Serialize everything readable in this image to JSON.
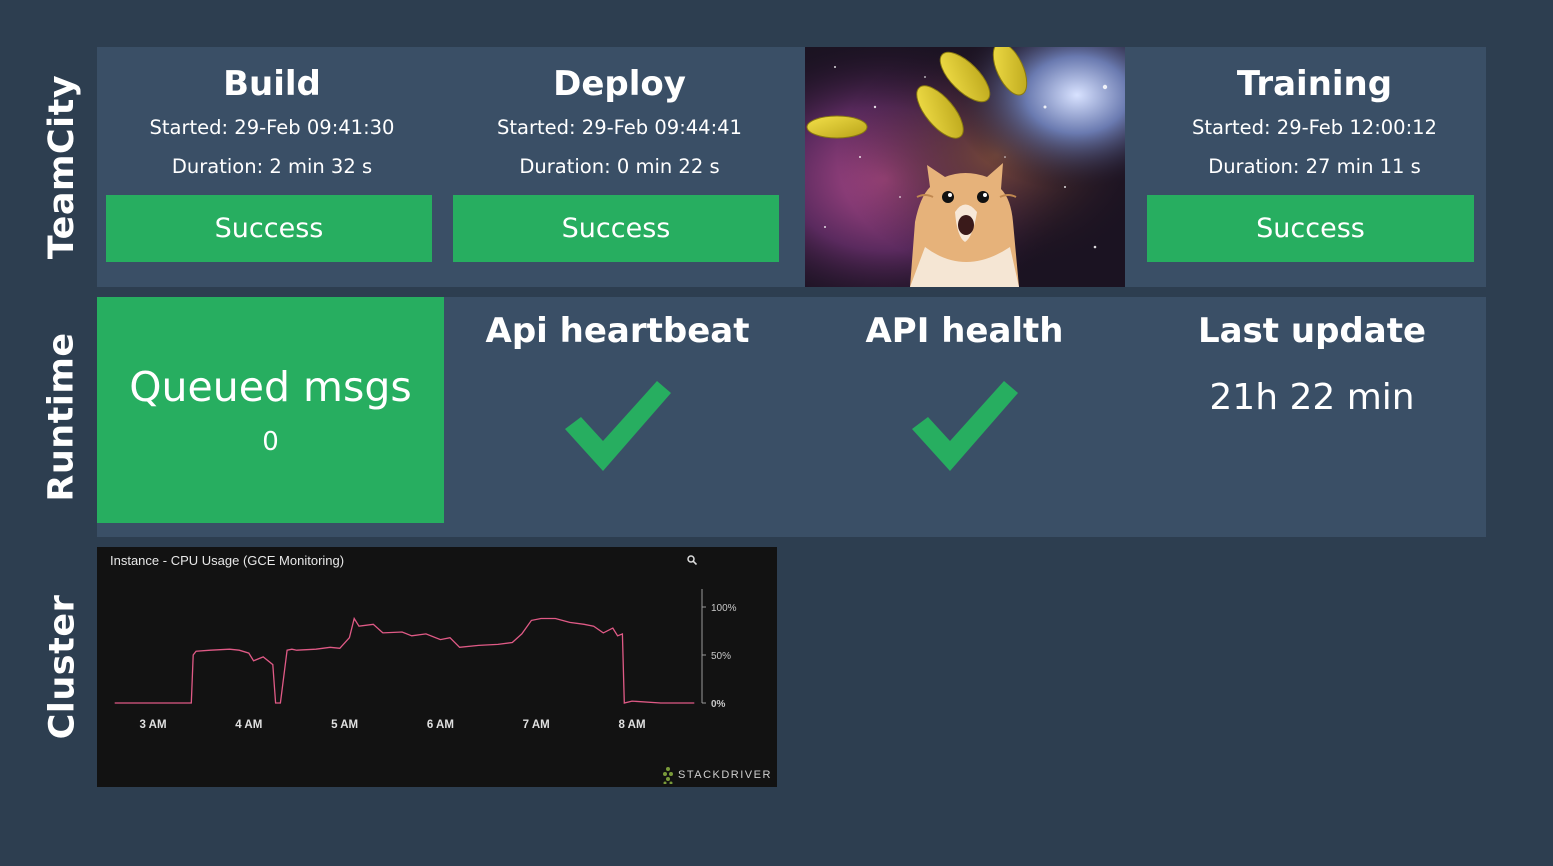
{
  "rows": {
    "teamcity": "TeamCity",
    "runtime": "Runtime",
    "cluster": "Cluster"
  },
  "builds": [
    {
      "title": "Build",
      "started": "Started: 29-Feb 09:41:30",
      "duration": "Duration: 2 min 32 s",
      "status": "Success"
    },
    {
      "title": "Deploy",
      "started": "Started: 29-Feb 09:44:41",
      "duration": "Duration: 0 min 22 s",
      "status": "Success"
    },
    {
      "title": "Training",
      "started": "Started: 29-Feb 12:00:12",
      "duration": "Duration: 27 min 11 s",
      "status": "Success"
    }
  ],
  "runtime": {
    "queued_label": "Queued msgs",
    "queued_value": "0",
    "heartbeat_label": "Api heartbeat",
    "health_label": "API health",
    "last_update_label": "Last update",
    "last_update_value": "21h 22 min"
  },
  "colors": {
    "background": "#2d3e50",
    "panel": "#3a4f66",
    "success": "#27ae60",
    "chart_bg": "#121212",
    "chart_line": "#e05a86"
  },
  "icons": {
    "heartbeat": "checkmark-icon",
    "health": "checkmark-icon",
    "chart_zoom": "magnifier-icon",
    "brand": "stackdriver-logo-icon"
  },
  "chart_brand": "STACKDRIVER",
  "chart_data": {
    "type": "line",
    "title": "Instance - CPU Usage (GCE Monitoring)",
    "xlabel": "",
    "ylabel": "",
    "x_ticks": [
      "3 AM",
      "4 AM",
      "5 AM",
      "6 AM",
      "7 AM",
      "8 AM"
    ],
    "y_ticks": [
      "100%",
      "50%",
      "0%"
    ],
    "ylim": [
      0,
      100
    ],
    "y_axis_position": "right",
    "grid": false,
    "series": [
      {
        "x": [
          2.6,
          2.9,
          3.2,
          3.4,
          3.42,
          3.45,
          3.6,
          3.8,
          3.9,
          4.0,
          4.05,
          4.15,
          4.25,
          4.28,
          4.33,
          4.4,
          4.45,
          4.5,
          4.7,
          4.85,
          4.95,
          5.05,
          5.1,
          5.15,
          5.3,
          5.4,
          5.6,
          5.7,
          5.85,
          6.0,
          6.1,
          6.2,
          6.4,
          6.6,
          6.75,
          6.85,
          6.95,
          7.05,
          7.2,
          7.35,
          7.5,
          7.6,
          7.7,
          7.8,
          7.85,
          7.9,
          7.92,
          8.0,
          8.3,
          8.65
        ],
        "y": [
          0,
          0,
          0,
          0,
          50,
          54,
          55,
          56,
          55,
          52,
          44,
          48,
          40,
          0,
          0,
          55,
          56,
          55,
          56,
          58,
          57,
          68,
          88,
          80,
          82,
          73,
          74,
          70,
          72,
          66,
          68,
          58,
          60,
          61,
          63,
          72,
          86,
          88,
          88,
          84,
          82,
          80,
          73,
          78,
          70,
          72,
          0,
          2,
          0,
          0
        ]
      }
    ]
  }
}
